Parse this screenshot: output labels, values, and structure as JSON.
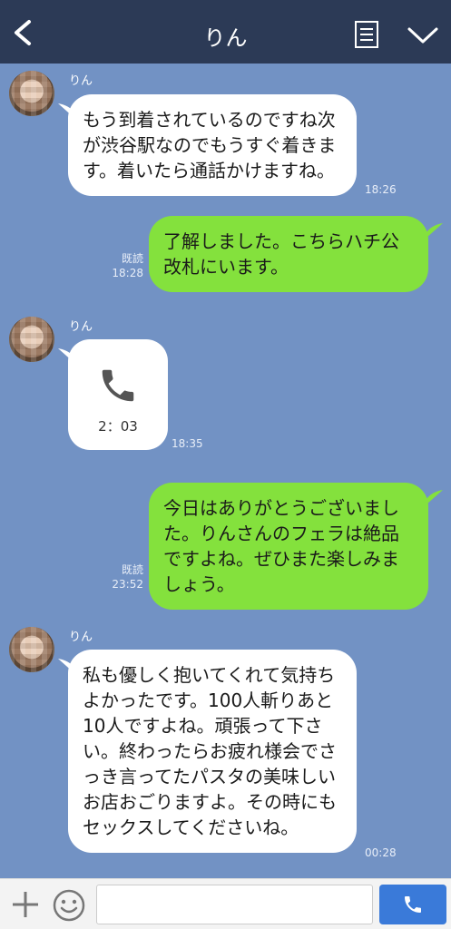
{
  "header": {
    "title": "りん",
    "back_icon": "chevron-left-icon",
    "notes_icon": "notes-icon",
    "menu_icon": "chevron-down-icon"
  },
  "messages": [
    {
      "type": "text",
      "from": "them",
      "sender": "りん",
      "text": "もう到着されているのですね次が渋谷駅なのでもうすぐ着きます。着いたら通話かけますね。",
      "time": "18:26"
    },
    {
      "type": "text",
      "from": "me",
      "text": "了解しました。こちらハチ公改札にいます。",
      "read": "既読",
      "time": "18:28"
    },
    {
      "type": "call",
      "from": "them",
      "sender": "りん",
      "duration": "2：03",
      "time": "18:35"
    },
    {
      "type": "text",
      "from": "me",
      "text": "今日はありがとうございました。りんさんのフェラは絶品ですよね。ぜひまた楽しみましょう。",
      "read": "既読",
      "time": "23:52"
    },
    {
      "type": "text",
      "from": "them",
      "sender": "りん",
      "text": "私も優しく抱いてくれて気持ちよかったです。100人斬りあと10人ですよね。頑張って下さい。終わったらお疲れ様会でさっき言ってたパスタの美味しいお店おごりますよ。その時にもセックスしてくださいね。",
      "time": "00:28"
    }
  ],
  "footer": {
    "plus_icon": "plus-icon",
    "emoji_icon": "emoji-icon",
    "input_value": "",
    "call_icon": "phone-icon"
  },
  "colors": {
    "background": "#7292c4",
    "header": "#2c3a56",
    "my_bubble": "#84e13d",
    "their_bubble": "#ffffff",
    "call_button": "#3a7ad9"
  }
}
